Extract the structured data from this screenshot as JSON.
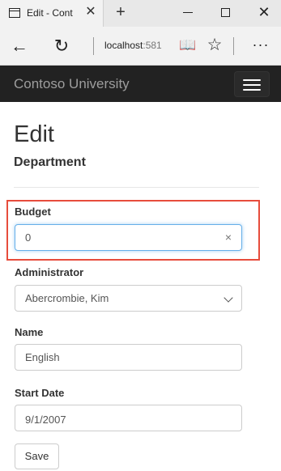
{
  "browser": {
    "tab_title": "Edit - Cont",
    "tab_close": "✕",
    "new_tab": "+",
    "window_close": "✕",
    "url_host": "localhost",
    "url_port": ":581",
    "icons": [
      "tab-page-icon",
      "back-arrow-icon",
      "refresh-icon",
      "reading-view-icon",
      "favorite-star-icon",
      "more-dots-icon"
    ]
  },
  "navbar": {
    "brand": "Contoso University"
  },
  "page": {
    "title": "Edit",
    "subtitle": "Department"
  },
  "form": {
    "budget": {
      "label": "Budget",
      "value": "0",
      "clear": "×"
    },
    "administrator": {
      "label": "Administrator",
      "selected": "Abercrombie, Kim"
    },
    "name": {
      "label": "Name",
      "value": "English"
    },
    "start_date": {
      "label": "Start Date",
      "value": "9/1/2007"
    },
    "save_label": "Save"
  },
  "colors": {
    "navbar_bg": "#222222",
    "brand_text": "#9d9d9d",
    "highlight_border": "#e74c3c",
    "focus_border": "#66afe9"
  }
}
